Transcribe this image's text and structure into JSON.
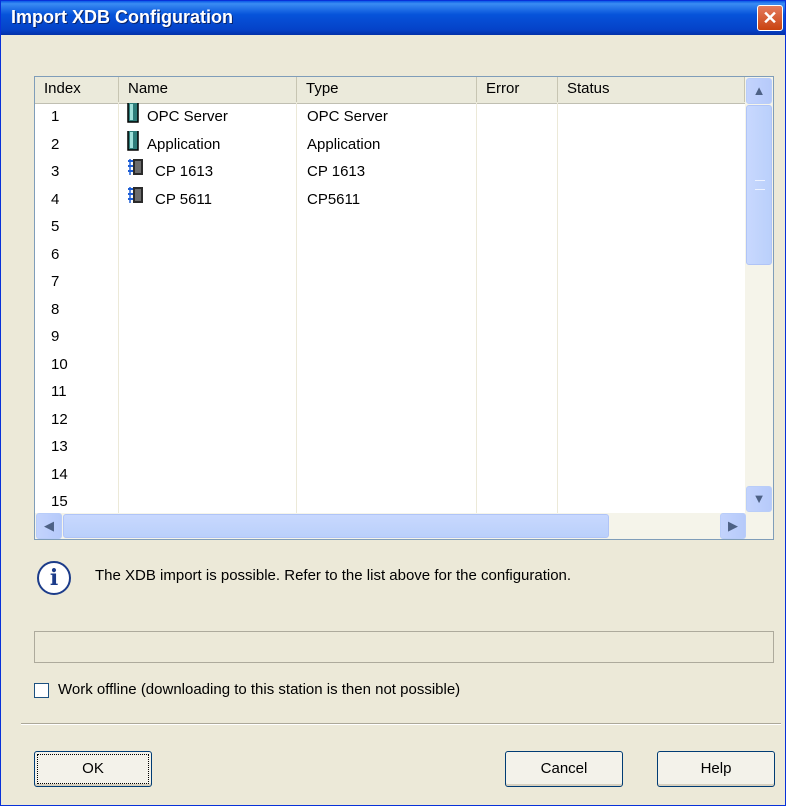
{
  "window": {
    "title": "Import XDB Configuration",
    "close_symbol": "✕"
  },
  "table": {
    "columns": [
      "Index",
      "Name",
      "Type",
      "Error",
      "Status"
    ],
    "rows": [
      {
        "index": "1",
        "name": "OPC Server",
        "type": "OPC Server",
        "icon": "application-icon"
      },
      {
        "index": "2",
        "name": "Application",
        "type": "Application",
        "icon": "application-icon"
      },
      {
        "index": "3",
        "name": "CP 1613",
        "type": "CP 1613",
        "icon": "network-card-icon"
      },
      {
        "index": "4",
        "name": "CP 5611",
        "type": "CP5611",
        "icon": "network-card-icon"
      },
      {
        "index": "5",
        "name": "",
        "type": ""
      },
      {
        "index": "6",
        "name": "",
        "type": ""
      },
      {
        "index": "7",
        "name": "",
        "type": ""
      },
      {
        "index": "8",
        "name": "",
        "type": ""
      },
      {
        "index": "9",
        "name": "",
        "type": ""
      },
      {
        "index": "10",
        "name": "",
        "type": ""
      },
      {
        "index": "11",
        "name": "",
        "type": ""
      },
      {
        "index": "12",
        "name": "",
        "type": ""
      },
      {
        "index": "13",
        "name": "",
        "type": ""
      },
      {
        "index": "14",
        "name": "",
        "type": ""
      },
      {
        "index": "15",
        "name": "",
        "type": ""
      }
    ]
  },
  "info": {
    "icon": "info-icon",
    "message": "The XDB import is possible. Refer to the list above for the configuration."
  },
  "options": {
    "work_offline_label": "Work offline (downloading to this station is then not possible)",
    "work_offline_checked": false
  },
  "buttons": {
    "ok": "OK",
    "cancel": "Cancel",
    "help": "Help"
  }
}
